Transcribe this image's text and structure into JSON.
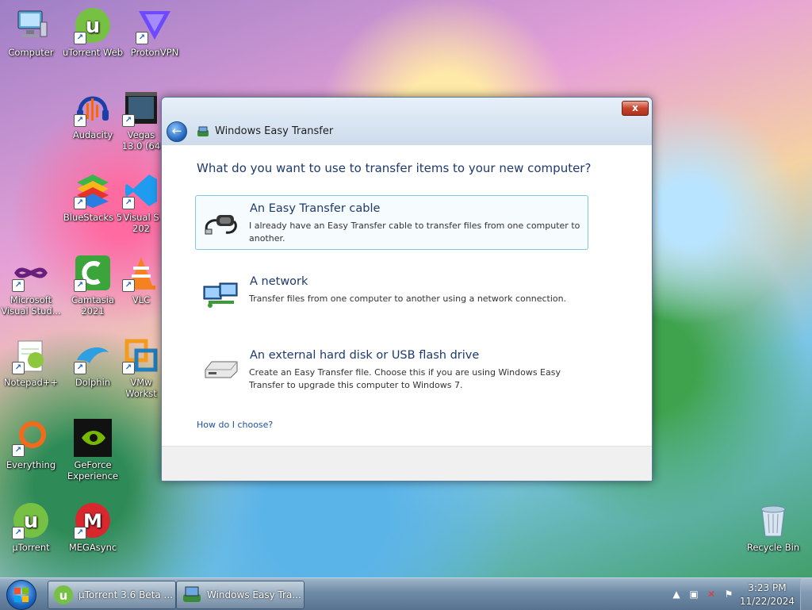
{
  "desktop": {
    "icons": [
      {
        "label": "Computer",
        "icon": "computer-icon",
        "shortcut": false
      },
      {
        "label": "uTorrent Web",
        "icon": "utorrent-web-icon",
        "shortcut": true
      },
      {
        "label": "ProtonVPN",
        "icon": "protonvpn-icon",
        "shortcut": true
      },
      {
        "label": "Audacity",
        "icon": "audacity-icon",
        "shortcut": true
      },
      {
        "label": "Vegas 13.0 (64",
        "icon": "vegas-icon",
        "shortcut": true
      },
      {
        "label": "BlueStacks 5",
        "icon": "bluestacks-icon",
        "shortcut": true
      },
      {
        "label": "Visual S 202",
        "icon": "visual-studio-code-icon",
        "shortcut": true
      },
      {
        "label": "Microsoft Visual Stud...",
        "icon": "visual-studio-icon",
        "shortcut": true
      },
      {
        "label": "Camtasia 2021",
        "icon": "camtasia-icon",
        "shortcut": true
      },
      {
        "label": "VLC",
        "icon": "vlc-icon",
        "shortcut": true
      },
      {
        "label": "Notepad++",
        "icon": "notepadpp-icon",
        "shortcut": true
      },
      {
        "label": "Dolphin",
        "icon": "dolphin-icon",
        "shortcut": true
      },
      {
        "label": "VMw Workst",
        "icon": "vmware-icon",
        "shortcut": true
      },
      {
        "label": "Everything",
        "icon": "everything-icon",
        "shortcut": true
      },
      {
        "label": "GeForce Experience",
        "icon": "geforce-icon",
        "shortcut": true
      },
      {
        "label": "µTorrent",
        "icon": "utorrent-icon",
        "shortcut": true
      },
      {
        "label": "MEGAsync",
        "icon": "megasync-icon",
        "shortcut": true
      },
      {
        "label": "Recycle Bin",
        "icon": "recycle-bin-icon",
        "shortcut": false
      }
    ]
  },
  "window": {
    "title": "Windows Easy Transfer",
    "close_label": "x",
    "question": "What do you want to use to transfer items to your new computer?",
    "options": [
      {
        "title": "An Easy Transfer cable",
        "description": "I already have an Easy Transfer cable to transfer files from one computer to another."
      },
      {
        "title": "A network",
        "description": "Transfer files from one computer to another using a network connection."
      },
      {
        "title": "An external hard disk or USB flash drive",
        "description": "Create an Easy Transfer file. Choose this if you are using Windows Easy Transfer to upgrade this computer to Windows 7."
      }
    ],
    "help_link": "How do I choose?"
  },
  "taskbar": {
    "buttons": [
      {
        "label": "µTorrent 3.6 Beta ...",
        "icon": "utorrent-icon"
      },
      {
        "label": "Windows Easy Tra...",
        "icon": "easy-transfer-icon"
      }
    ],
    "clock": {
      "time": "3:23 PM",
      "date": "11/22/2024"
    }
  },
  "colors": {
    "accent": "#1e3a6e",
    "selected_border": "#84c6e6",
    "link": "#1e4fa8",
    "close": "#c7432d"
  }
}
